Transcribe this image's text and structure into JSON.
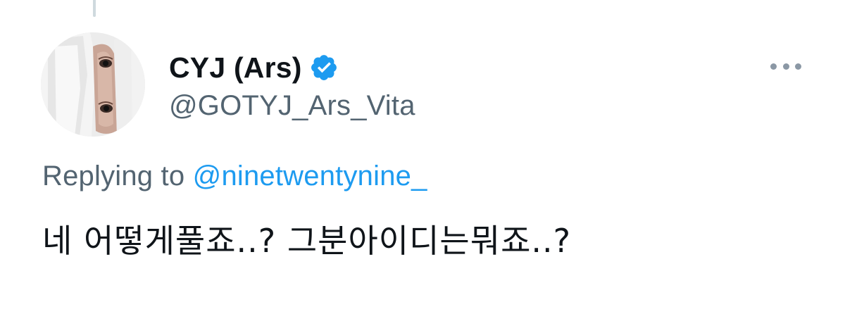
{
  "tweet": {
    "author": {
      "display_name": "CYJ (Ars)",
      "handle": "@GOTYJ_Ars_Vita",
      "verified": true,
      "verified_color": "#1d9bf0",
      "avatar_icon": "profile-photo"
    },
    "reply": {
      "prefix": "Replying to ",
      "mention": "@ninetwentynine_"
    },
    "text": "네 어떻게풀죠..? 그분아이디는뭐죠..?",
    "more_icon": "more-horizontal-icon"
  },
  "colors": {
    "primary_text": "#0f1419",
    "secondary_text": "#536471",
    "link": "#1d9bf0",
    "thread_line": "#cfd9de"
  }
}
